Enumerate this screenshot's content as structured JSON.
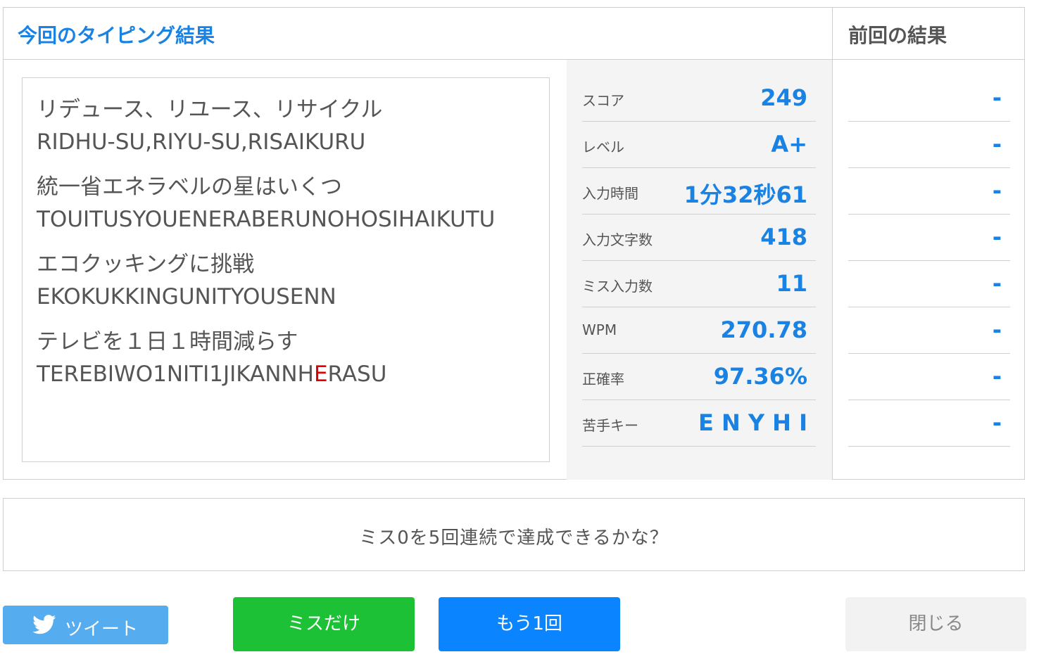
{
  "current": {
    "title": "今回のタイピング結果",
    "entries": [
      {
        "ja": "リデュース、リユース、リサイクル",
        "romaji": "RIDHU-SU,RIYU-SU,RISAIKURU"
      },
      {
        "ja": "統一省エネラベルの星はいくつ",
        "romaji": "TOUITUSYOUENERABERUNOHOSIHAIKUTU"
      },
      {
        "ja": "エコクッキングに挑戦",
        "romaji": "EKOKUKKINGUNITYOUSENN"
      },
      {
        "ja": "テレビを１日１時間減らす",
        "romaji_before": "TEREBIWO1NITI1JIKANNH",
        "romaji_miss": "E",
        "romaji_after": "RASU"
      }
    ],
    "stats": [
      {
        "label": "スコア",
        "value": "249"
      },
      {
        "label": "レベル",
        "value": "A+"
      },
      {
        "label": "入力時間",
        "value": "1分32秒61"
      },
      {
        "label": "入力文字数",
        "value": "418"
      },
      {
        "label": "ミス入力数",
        "value": "11"
      },
      {
        "label": "WPM",
        "value": "270.78"
      },
      {
        "label": "正確率",
        "value": "97.36%"
      },
      {
        "label": "苦手キー",
        "value": "E N Y H I"
      }
    ]
  },
  "previous": {
    "title": "前回の結果",
    "values": [
      "-",
      "-",
      "-",
      "-",
      "-",
      "-",
      "-",
      "-"
    ]
  },
  "message": "ミス0を5回連続で達成できるかな？",
  "buttons": {
    "tweet": "ツイート",
    "miss_only": "ミスだけ",
    "again": "もう1回",
    "close": "閉じる"
  },
  "colors": {
    "accent": "#1a82e2",
    "miss": "#e00000",
    "tweet": "#55acee",
    "miss_button": "#1dc136",
    "again_button": "#0a84ff"
  }
}
